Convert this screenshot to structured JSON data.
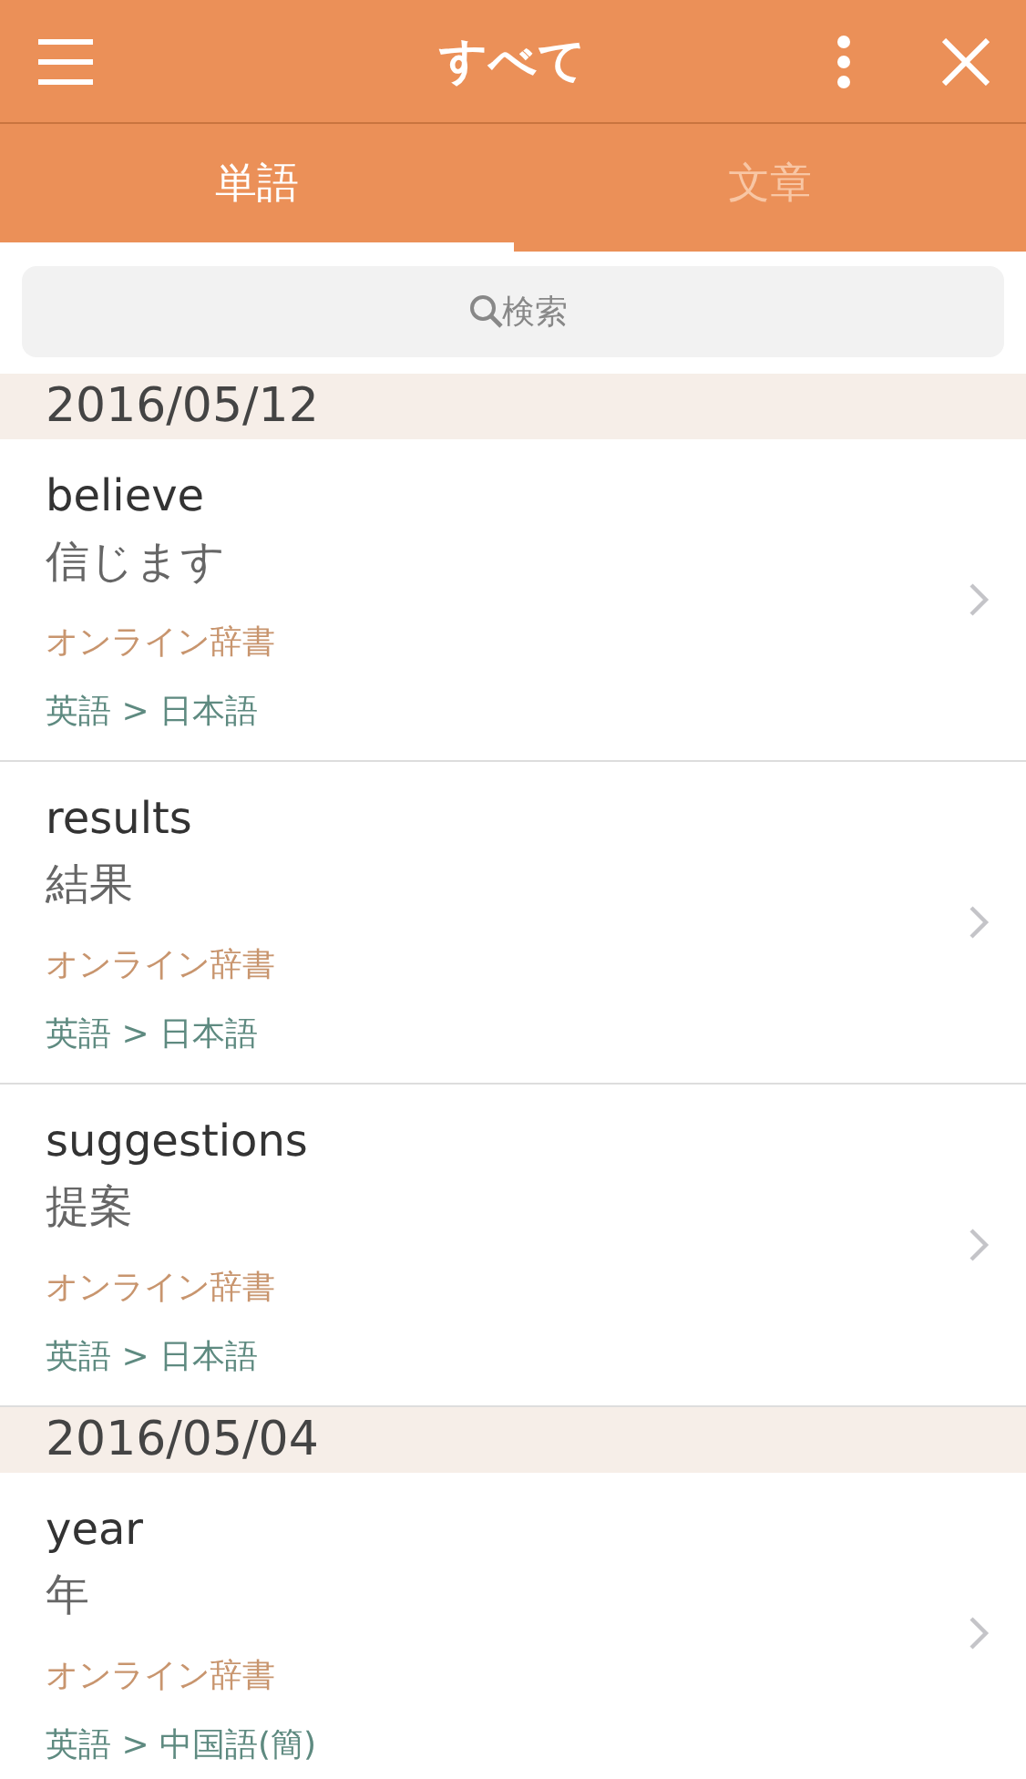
{
  "header": {
    "title": "すべて"
  },
  "tabs": [
    {
      "label": "単語",
      "selected": true
    },
    {
      "label": "文章",
      "selected": false
    }
  ],
  "search": {
    "placeholder": "検索"
  },
  "sections": [
    {
      "date": "2016/05/12",
      "entries": [
        {
          "word": "believe",
          "meaning": "信じます",
          "source": "オンライン辞書",
          "languages": "英語 > 日本語"
        },
        {
          "word": "results",
          "meaning": "結果",
          "source": "オンライン辞書",
          "languages": "英語 > 日本語"
        },
        {
          "word": "suggestions",
          "meaning": "提案",
          "source": "オンライン辞書",
          "languages": "英語 > 日本語"
        }
      ]
    },
    {
      "date": "2016/05/04",
      "entries": [
        {
          "word": "year",
          "meaning": "年",
          "source": "オンライン辞書",
          "languages": "英語 > 中国語(簡)"
        }
      ]
    }
  ]
}
